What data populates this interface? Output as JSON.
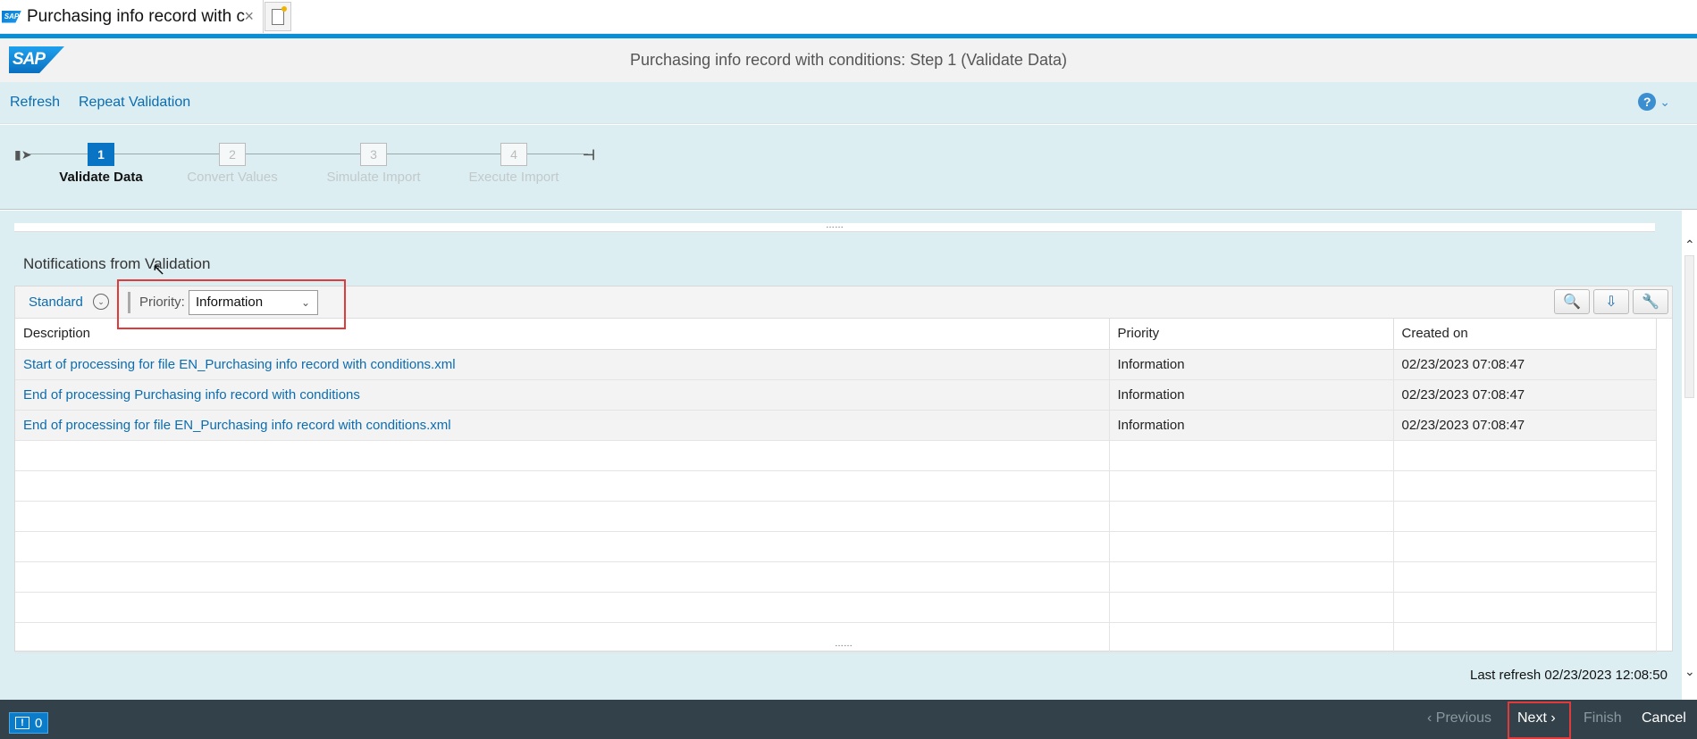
{
  "browser": {
    "tab_title": "Purchasing info record with c...",
    "close_glyph": "×"
  },
  "shell": {
    "logo_text": "SAP",
    "title": "Purchasing info record with conditions: Step 1  (Validate Data)"
  },
  "toolbar": {
    "refresh": "Refresh",
    "repeat_validation": "Repeat Validation",
    "help_glyph": "?"
  },
  "roadmap": {
    "steps": [
      {
        "number": "1",
        "label": "Validate Data",
        "active": true
      },
      {
        "number": "2",
        "label": "Convert Values",
        "active": false
      },
      {
        "number": "3",
        "label": "Simulate Import",
        "active": false
      },
      {
        "number": "4",
        "label": "Execute Import",
        "active": false
      }
    ]
  },
  "notifications": {
    "title": "Notifications from Validation",
    "variant": "Standard",
    "priority_label": "Priority:",
    "priority_value": "Information",
    "columns": [
      "Description",
      "Priority",
      "Created on"
    ],
    "rows": [
      {
        "description": "Start of processing for file EN_Purchasing info record with conditions.xml",
        "priority": "Information",
        "created_on": "02/23/2023 07:08:47"
      },
      {
        "description": "End of processing Purchasing info record with conditions",
        "priority": "Information",
        "created_on": "02/23/2023 07:08:47"
      },
      {
        "description": "End of processing for file EN_Purchasing info record with conditions.xml",
        "priority": "Information",
        "created_on": "02/23/2023 07:08:47"
      }
    ],
    "icons": [
      "search-icon",
      "export-icon",
      "settings-icon"
    ]
  },
  "status": {
    "last_refresh": "Last refresh 02/23/2023 12:08:50"
  },
  "footer": {
    "message_count": "0",
    "previous": "Previous",
    "next": "Next",
    "finish": "Finish",
    "cancel": "Cancel"
  },
  "colors": {
    "accent": "#0a8fd6",
    "highlight": "#e03a3a",
    "link": "#0a6db1",
    "footer_bg": "#33414a"
  }
}
